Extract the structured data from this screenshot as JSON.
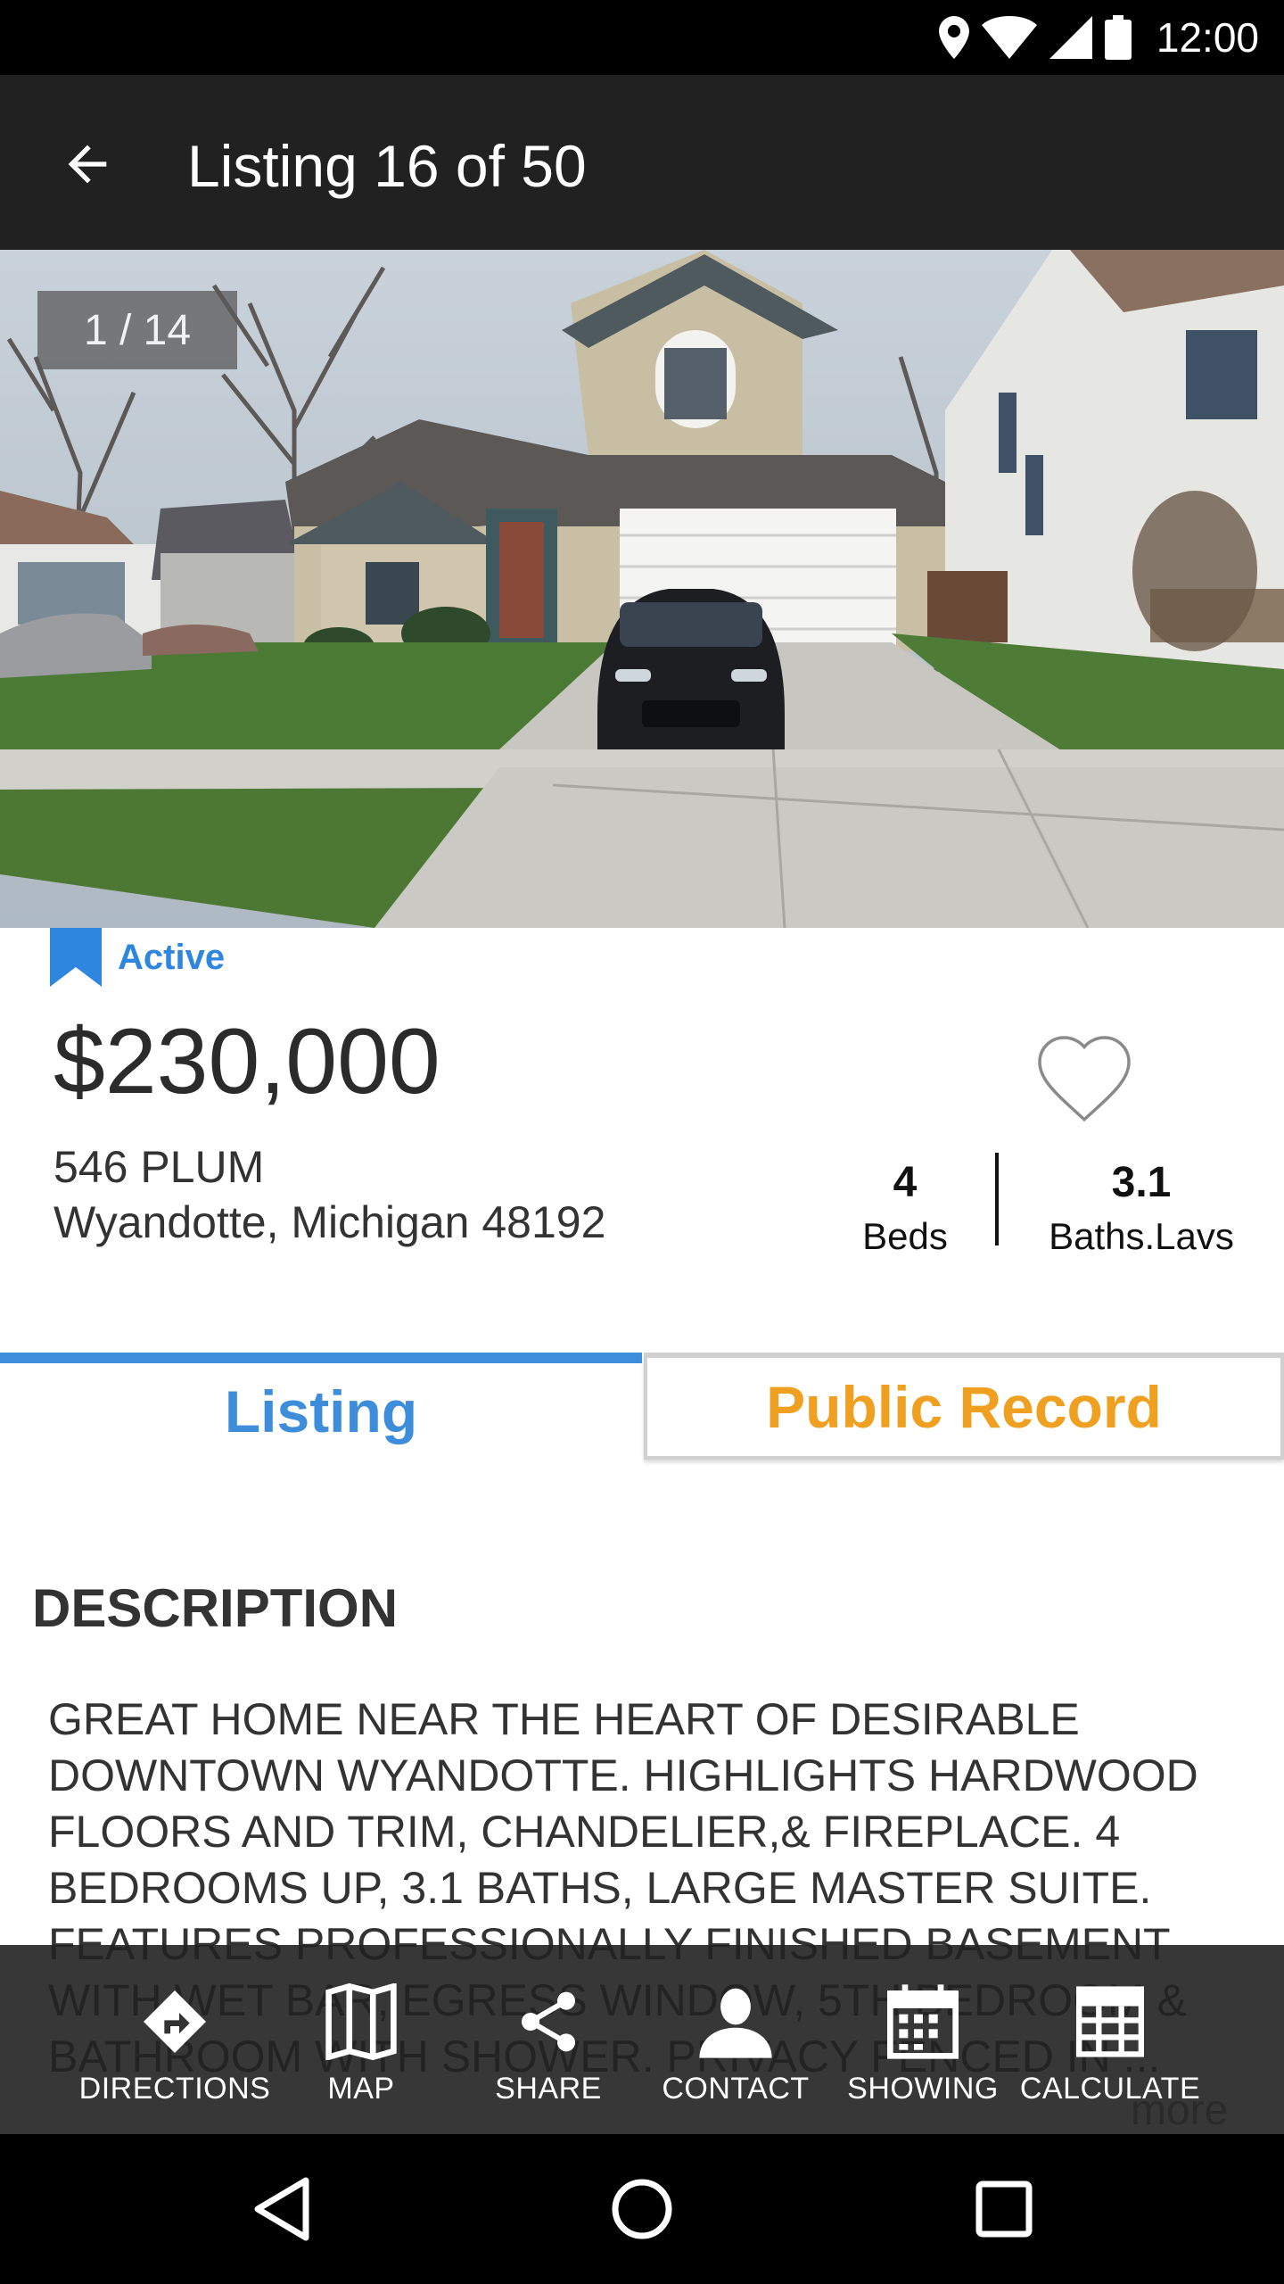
{
  "status_bar": {
    "time": "12:00",
    "icons": [
      "location-icon",
      "wifi-icon",
      "signal-icon",
      "battery-icon"
    ]
  },
  "app_bar": {
    "title": "Listing 16 of 50",
    "back_icon": "arrow-back-icon"
  },
  "photo": {
    "counter": "1 / 14"
  },
  "listing": {
    "status": "Active",
    "price": "$230,000",
    "address_line1": "546 PLUM",
    "address_line2": "Wyandotte, Michigan 48192",
    "beds": "4",
    "beds_label": "Beds",
    "baths": "3.1",
    "baths_label": "Baths.Lavs",
    "favorite_icon": "heart-outline-icon"
  },
  "tabs": [
    {
      "label": "Listing",
      "selected": true
    },
    {
      "label": "Public Record",
      "selected": false
    }
  ],
  "description": {
    "heading": "DESCRIPTION",
    "text": "GREAT HOME NEAR THE HEART OF DESIRABLE DOWNTOWN WYANDOTTE. HIGHLIGHTS HARDWOOD FLOORS AND TRIM, CHANDELIER,& FIREPLACE. 4 BEDROOMS UP, 3.1 BATHS, LARGE MASTER SUITE. FEATURES PROFESSIONALLY FINISHED BASEMENT WITH WET BAR, EGRESS WINDOW, 5TH BEDROOM & BATHROOM WITH SHOWER. PRIVACY FENCED IN ...",
    "more_label": "more"
  },
  "actions": [
    {
      "label": "DIRECTIONS",
      "icon": "directions-icon"
    },
    {
      "label": "MAP",
      "icon": "map-icon"
    },
    {
      "label": "SHARE",
      "icon": "share-icon"
    },
    {
      "label": "CONTACT",
      "icon": "contact-icon"
    },
    {
      "label": "SHOWING",
      "icon": "calendar-icon"
    },
    {
      "label": "CALCULATE",
      "icon": "calculator-icon"
    }
  ],
  "colors": {
    "accent_blue": "#3d8ddb",
    "accent_orange": "#f0a020",
    "app_bar": "#212121"
  }
}
